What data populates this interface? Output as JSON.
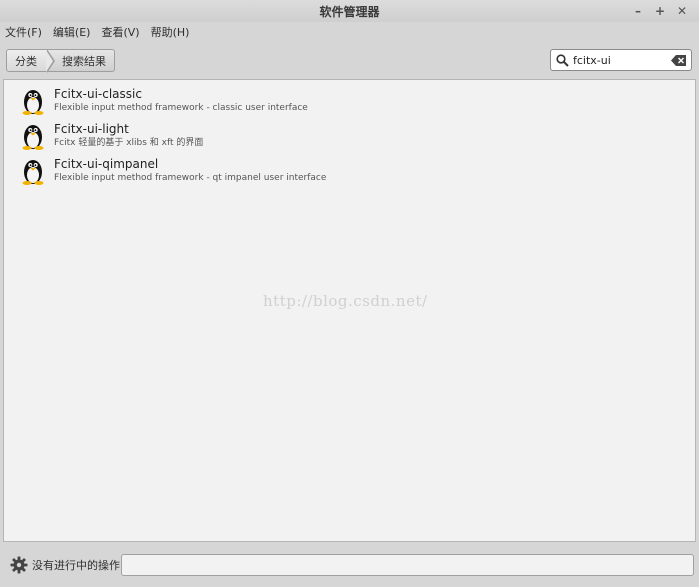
{
  "window": {
    "title": "软件管理器"
  },
  "window_controls": {
    "minimize": "–",
    "maximize": "+",
    "close": "✕"
  },
  "menu": [
    {
      "label": "文件(F)"
    },
    {
      "label": "编辑(E)"
    },
    {
      "label": "查看(V)"
    },
    {
      "label": "帮助(H)"
    }
  ],
  "breadcrumb": [
    {
      "label": "分类"
    },
    {
      "label": "搜索结果"
    }
  ],
  "search": {
    "value": "fcitx-ui",
    "placeholder": ""
  },
  "results": [
    {
      "name": "Fcitx-ui-classic",
      "description": "Flexible input method framework - classic user interface",
      "icon": "tux-penguin-icon"
    },
    {
      "name": "Fcitx-ui-light",
      "description": "Fcitx 轻量的基于 xlibs 和 xft 的界面",
      "icon": "tux-penguin-icon"
    },
    {
      "name": "Fcitx-ui-qimpanel",
      "description": "Flexible input method framework - qt impanel user interface",
      "icon": "tux-penguin-icon"
    }
  ],
  "watermark": "http://blog.csdn.net/",
  "status": {
    "text": "没有进行中的操作",
    "icon": "gear-icon",
    "progress": 0
  }
}
